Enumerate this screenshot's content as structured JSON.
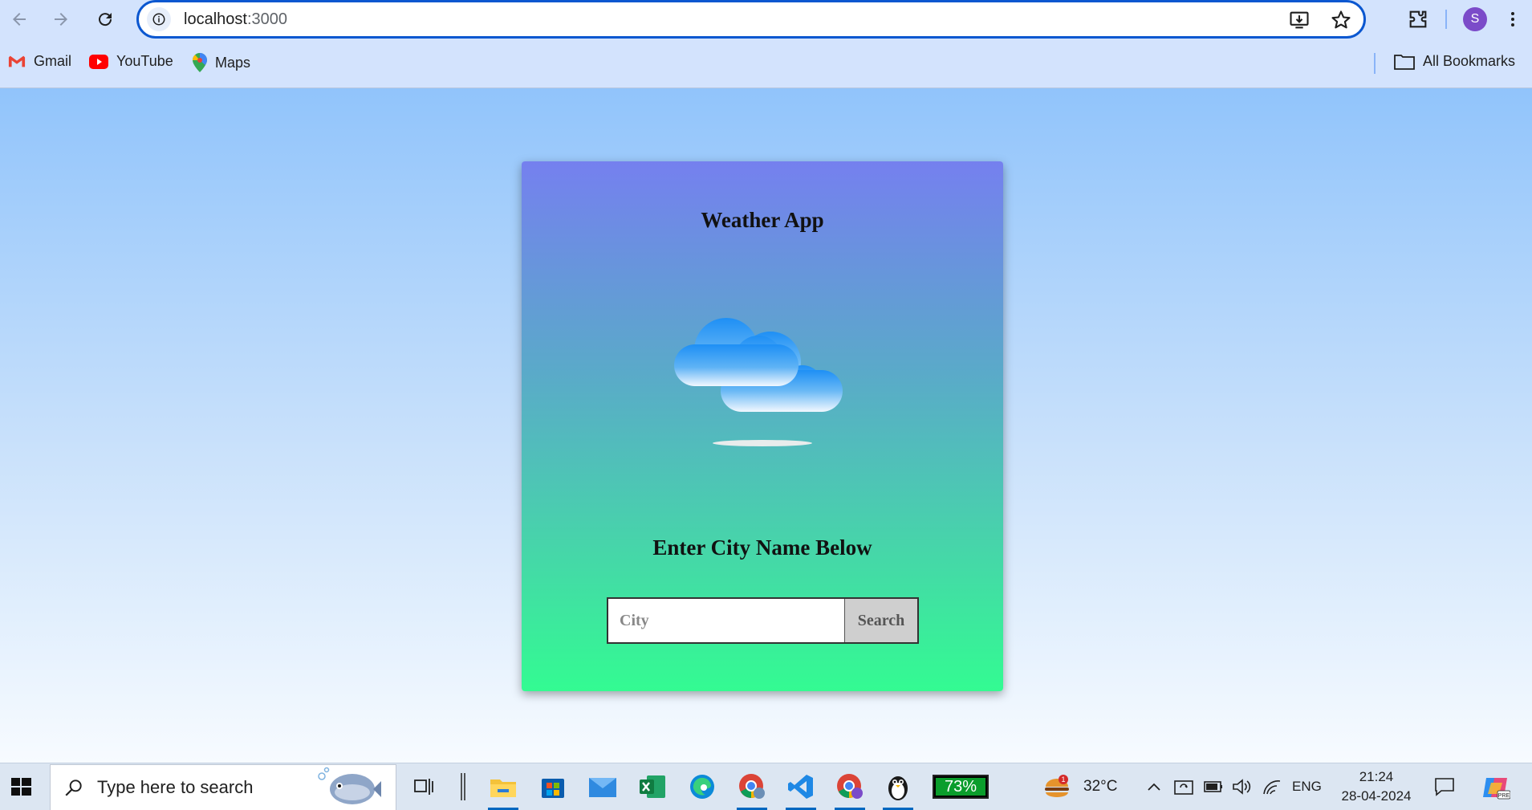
{
  "browser": {
    "url_host": "localhost",
    "url_port": ":3000",
    "profile_initial": "S",
    "bookmarks": [
      {
        "label": "Gmail",
        "icon": "gmail-icon"
      },
      {
        "label": "YouTube",
        "icon": "youtube-icon"
      },
      {
        "label": "Maps",
        "icon": "maps-icon"
      }
    ],
    "all_bookmarks_label": "All Bookmarks"
  },
  "app": {
    "title": "Weather App",
    "icon": "cloud-icon",
    "prompt": "Enter City Name Below",
    "city_placeholder": "City",
    "city_value": "",
    "search_label": "Search"
  },
  "taskbar": {
    "search_placeholder": "Type here to search",
    "battery": "73%",
    "weather_badge": "1",
    "temperature": "32°C",
    "language": "ENG",
    "time": "21:24",
    "date": "28-04-2024"
  },
  "colors": {
    "accent": "#0b57d0",
    "card_top": "#7580ef",
    "card_bottom": "#33fb92",
    "page_top": "#91c4fb"
  }
}
